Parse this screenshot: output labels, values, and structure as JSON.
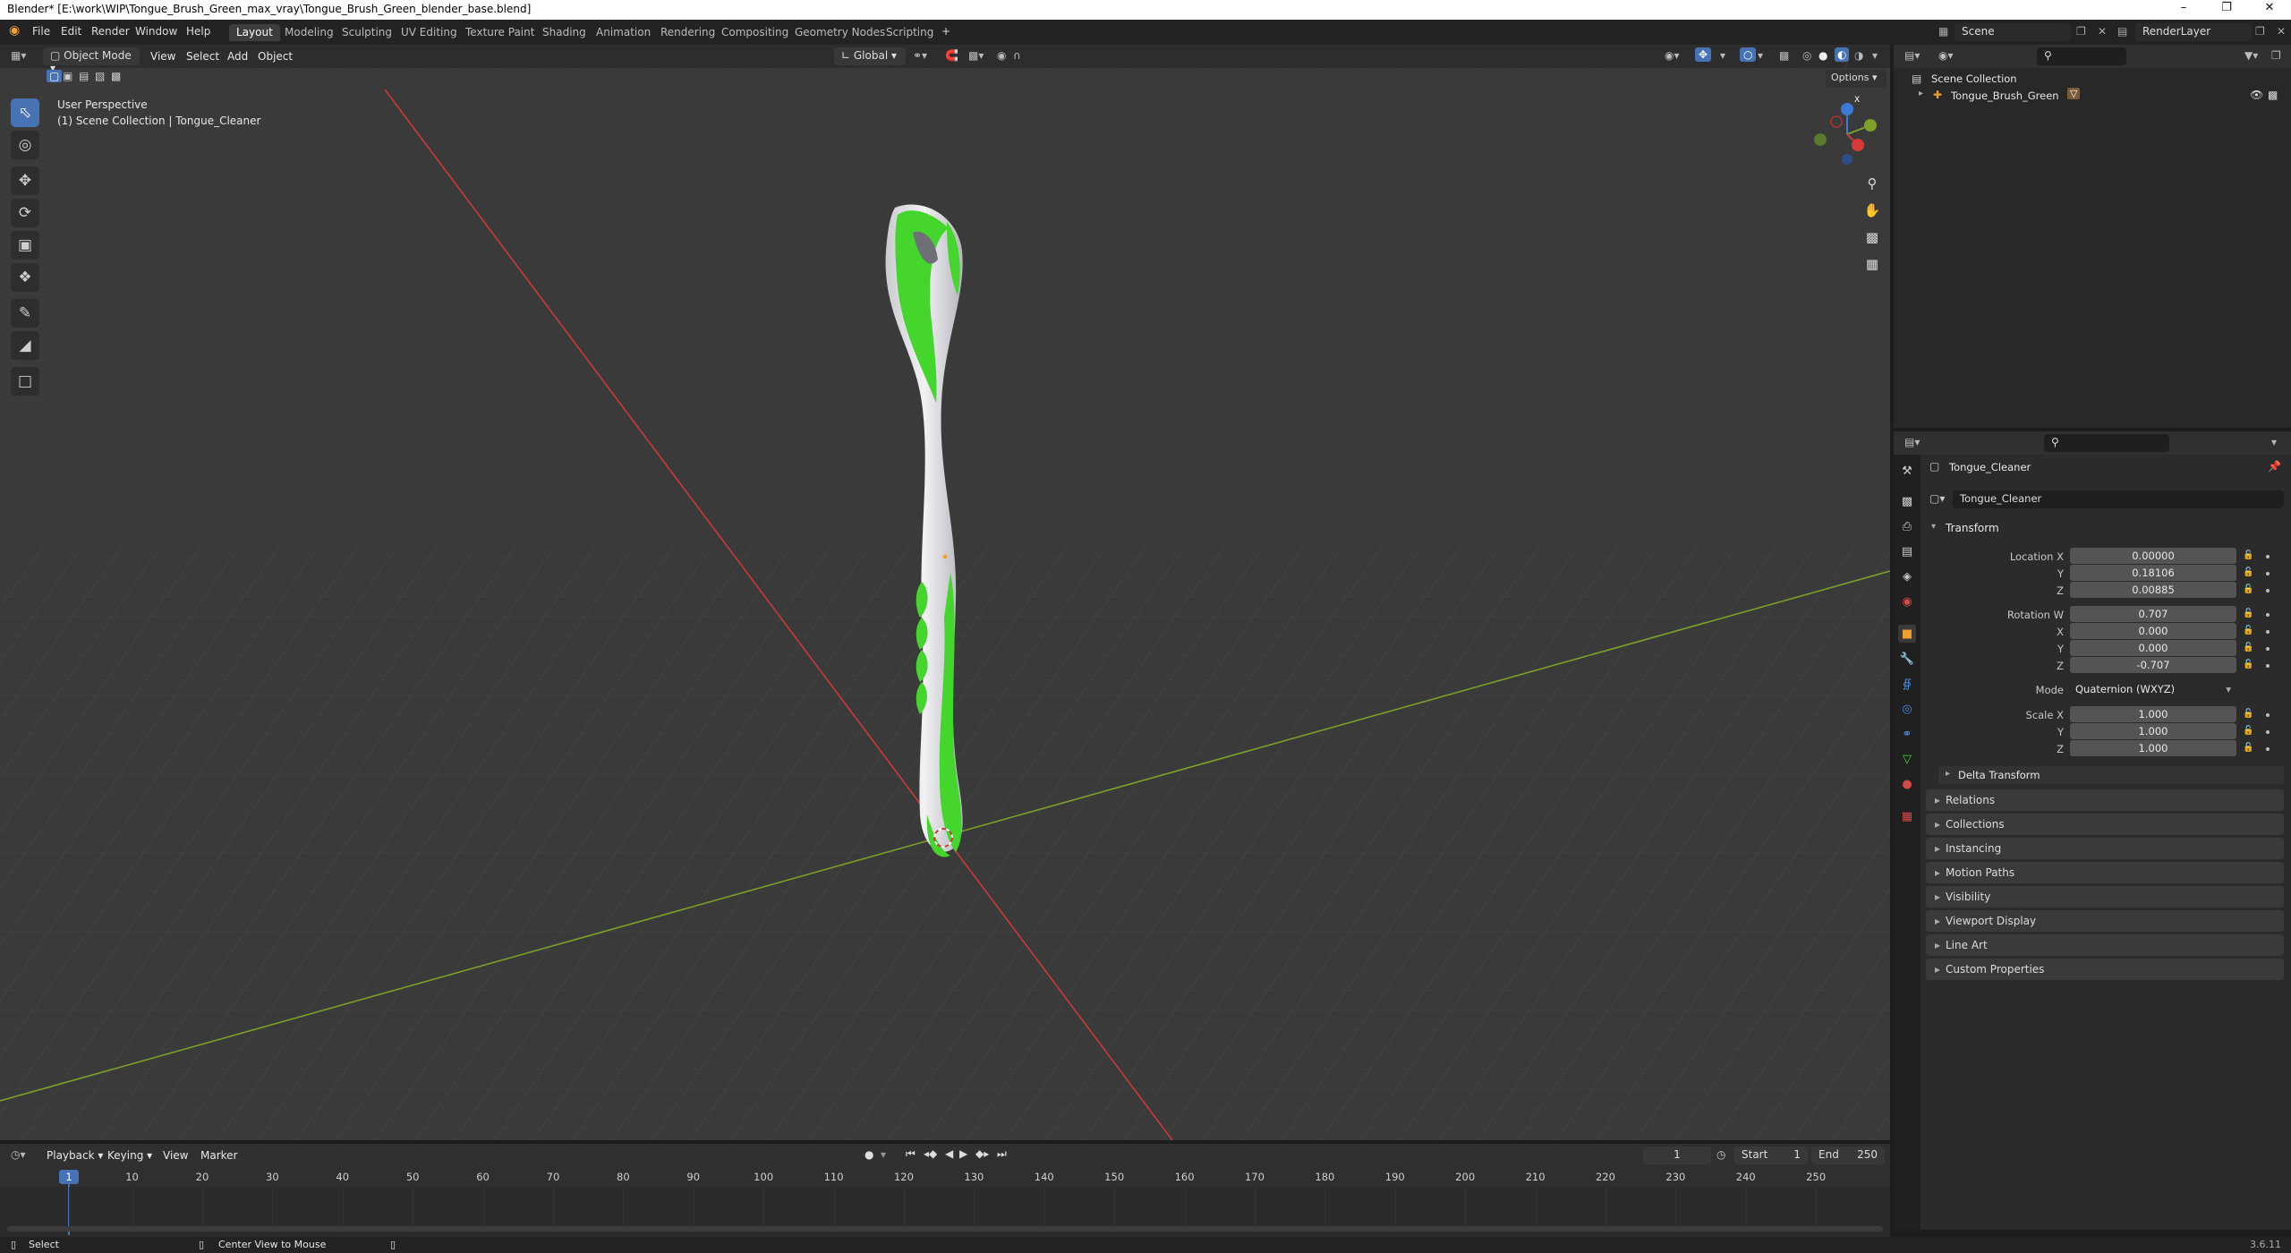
{
  "window": {
    "title": "Blender* [E:\\work\\WIP\\Tongue_Brush_Green_max_vray\\Tongue_Brush_Green_blender_base.blend]"
  },
  "menus": [
    "File",
    "Edit",
    "Render",
    "Window",
    "Help"
  ],
  "workspaces": [
    "Layout",
    "Modeling",
    "Sculpting",
    "UV Editing",
    "Texture Paint",
    "Shading",
    "Animation",
    "Rendering",
    "Compositing",
    "Geometry Nodes",
    "Scripting"
  ],
  "workspace_add": "+",
  "scene": {
    "name": "Scene",
    "view_layer": "RenderLayer"
  },
  "viewport": {
    "mode": "Object Mode",
    "menu": [
      "View",
      "Select",
      "Add",
      "Object"
    ],
    "orientation": "Global",
    "options_label": "Options",
    "perspective": "User Perspective",
    "collection_info": "(1) Scene Collection | Tongue_Cleaner",
    "gizmo": {
      "x": "X",
      "y": "Y",
      "z": "Z"
    }
  },
  "outliner": {
    "root": "Scene Collection",
    "items": [
      {
        "label": "Tongue_Brush_Green"
      }
    ]
  },
  "properties": {
    "object_name": "Tongue_Cleaner",
    "data_name": "Tongue_Cleaner",
    "transform": {
      "header": "Transform",
      "location_label": "Location X",
      "location": [
        "0.00000",
        "0.18106",
        "0.00885"
      ],
      "rotation_label": "Rotation W",
      "rotation": [
        "0.707",
        "0.000",
        "0.000",
        "-0.707"
      ],
      "mode_label": "Mode",
      "mode_value": "Quaternion (WXYZ)",
      "scale_label": "Scale X",
      "scale": [
        "1.000",
        "1.000",
        "1.000"
      ],
      "axis_y": "Y",
      "axis_z": "Z",
      "axis_x": "X"
    },
    "delta_transform": "Delta Transform",
    "panels": [
      "Relations",
      "Collections",
      "Instancing",
      "Motion Paths",
      "Visibility",
      "Viewport Display",
      "Line Art",
      "Custom Properties"
    ]
  },
  "timeline": {
    "menu": [
      "Playback",
      "Keying",
      "View",
      "Marker"
    ],
    "current_frame": "1",
    "start_label": "Start",
    "start": "1",
    "end_label": "End",
    "end": "250",
    "ruler": [
      "1",
      "10",
      "20",
      "30",
      "40",
      "50",
      "60",
      "70",
      "80",
      "90",
      "100",
      "110",
      "120",
      "130",
      "140",
      "150",
      "160",
      "170",
      "180",
      "190",
      "200",
      "210",
      "220",
      "230",
      "240",
      "250"
    ]
  },
  "statusbar": {
    "select": "Select",
    "center_view": "Center View to Mouse",
    "version": "3.6.11"
  },
  "colors": {
    "accent": "#4772b3",
    "object_green": "#44d62c",
    "x_axis": "#c83a3a",
    "y_axis": "#7da02a"
  }
}
